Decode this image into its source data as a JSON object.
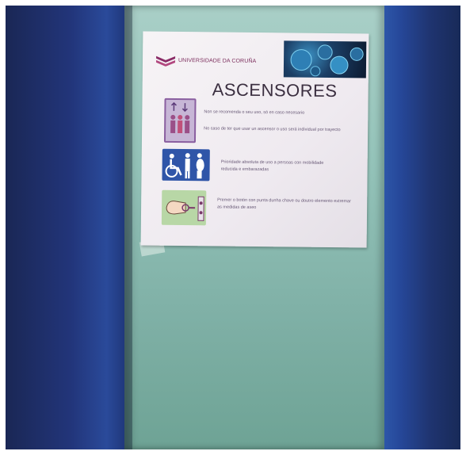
{
  "poster": {
    "logo_text": "UNIVERSIDADE DA CORUÑA",
    "title": "ASCENSORES",
    "rule1": "Non se recomenda o seu uso, só en caso necesario",
    "rule2": "No caso de ter que usar un ascensor o uso será individual por trayecto",
    "rule3": "Prioridade absoluta de uso a persoas con mobilidade reducida e embarazadas",
    "rule4": "Premer o botón con punta dunha chave ou doutro elemento extremar as medidas de aseo"
  },
  "colors": {
    "frame": "#22357a",
    "door": "#94c3b9",
    "poster": "#f4f0f3",
    "accent": "#8a2b66",
    "accessibility_blue": "#2f55a8"
  },
  "icons": [
    "elevator-people-icon",
    "accessibility-icon",
    "key-press-button-icon",
    "coronavirus-image"
  ]
}
